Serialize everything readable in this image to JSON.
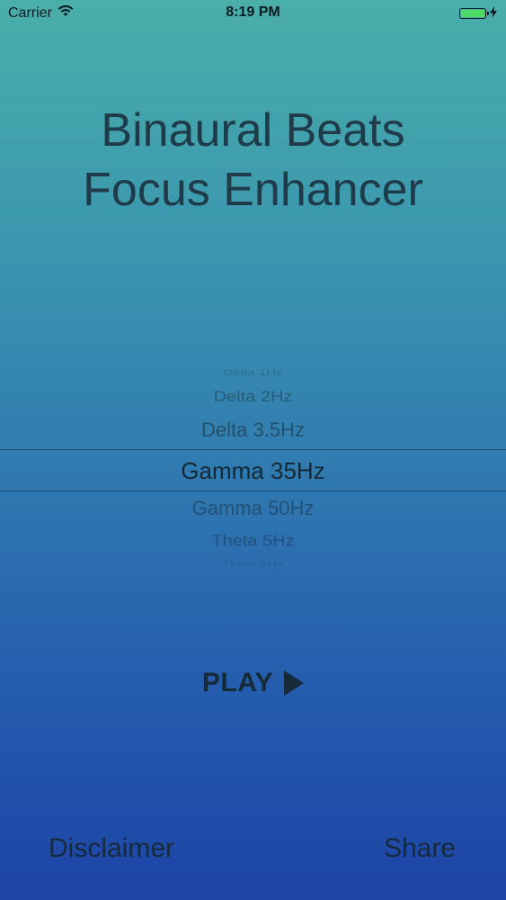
{
  "status_bar": {
    "carrier": "Carrier",
    "time": "8:19 PM",
    "battery_level": 1.0,
    "battery_color": "#4cd964"
  },
  "title": {
    "line1": "Binaural Beats",
    "line2": "Focus Enhancer"
  },
  "picker": {
    "items": [
      "Delta 1Hz",
      "Delta 2Hz",
      "Delta 3.5Hz",
      "Gamma 35Hz",
      "Gamma 50Hz",
      "Theta 5Hz",
      "Theta 6Hz"
    ],
    "selected": "Gamma 35Hz"
  },
  "play": {
    "label": "PLAY",
    "icon": "play-triangle-icon"
  },
  "bottom": {
    "disclaimer": "Disclaimer",
    "share": "Share"
  },
  "icons": {
    "wifi": "wifi-icon",
    "battery": "battery-icon",
    "charging": "charging-bolt-icon"
  }
}
